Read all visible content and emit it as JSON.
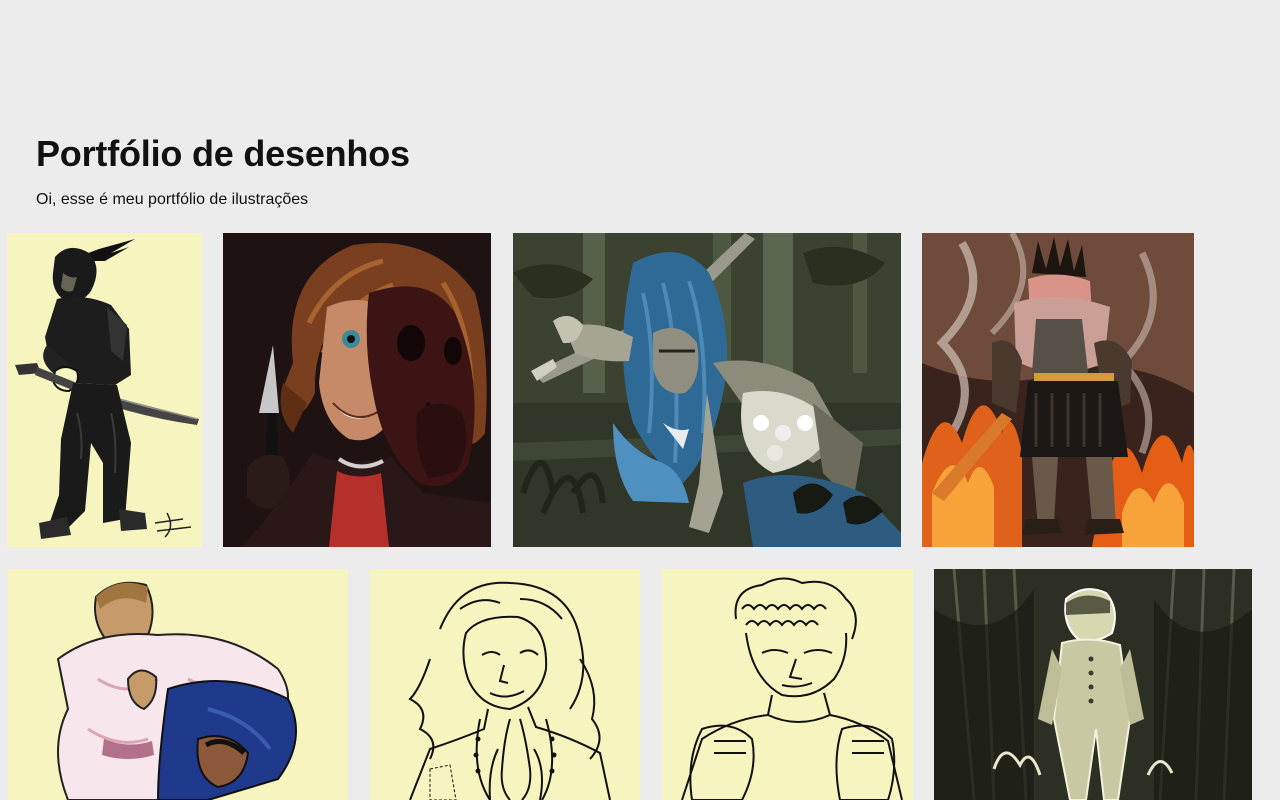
{
  "page": {
    "title": "Portfólio de desenhos",
    "subtitle": "Oi, esse é meu portfólio de ilustrações"
  },
  "gallery": {
    "items": [
      {
        "subject": "samurai-with-katana",
        "background": "#f6f4bf"
      },
      {
        "subject": "woman-with-mask-and-knife",
        "background": "#1e1212"
      },
      {
        "subject": "knight-with-greatsword-in-forest",
        "background": "#2f3426"
      },
      {
        "subject": "crowned-warrior-in-fire",
        "background": "#3b231d"
      },
      {
        "subject": "grappling-fighters",
        "background": "#f6f4bf"
      },
      {
        "subject": "woman-praying-line-art",
        "background": "#f6f4bf"
      },
      {
        "subject": "boxer-line-art",
        "background": "#f6f4bf"
      },
      {
        "subject": "boy-in-dark-shadows",
        "background": "#2e2f24"
      }
    ]
  },
  "colors": {
    "page_background": "#ececec",
    "pale_yellow": "#f6f4bf"
  }
}
